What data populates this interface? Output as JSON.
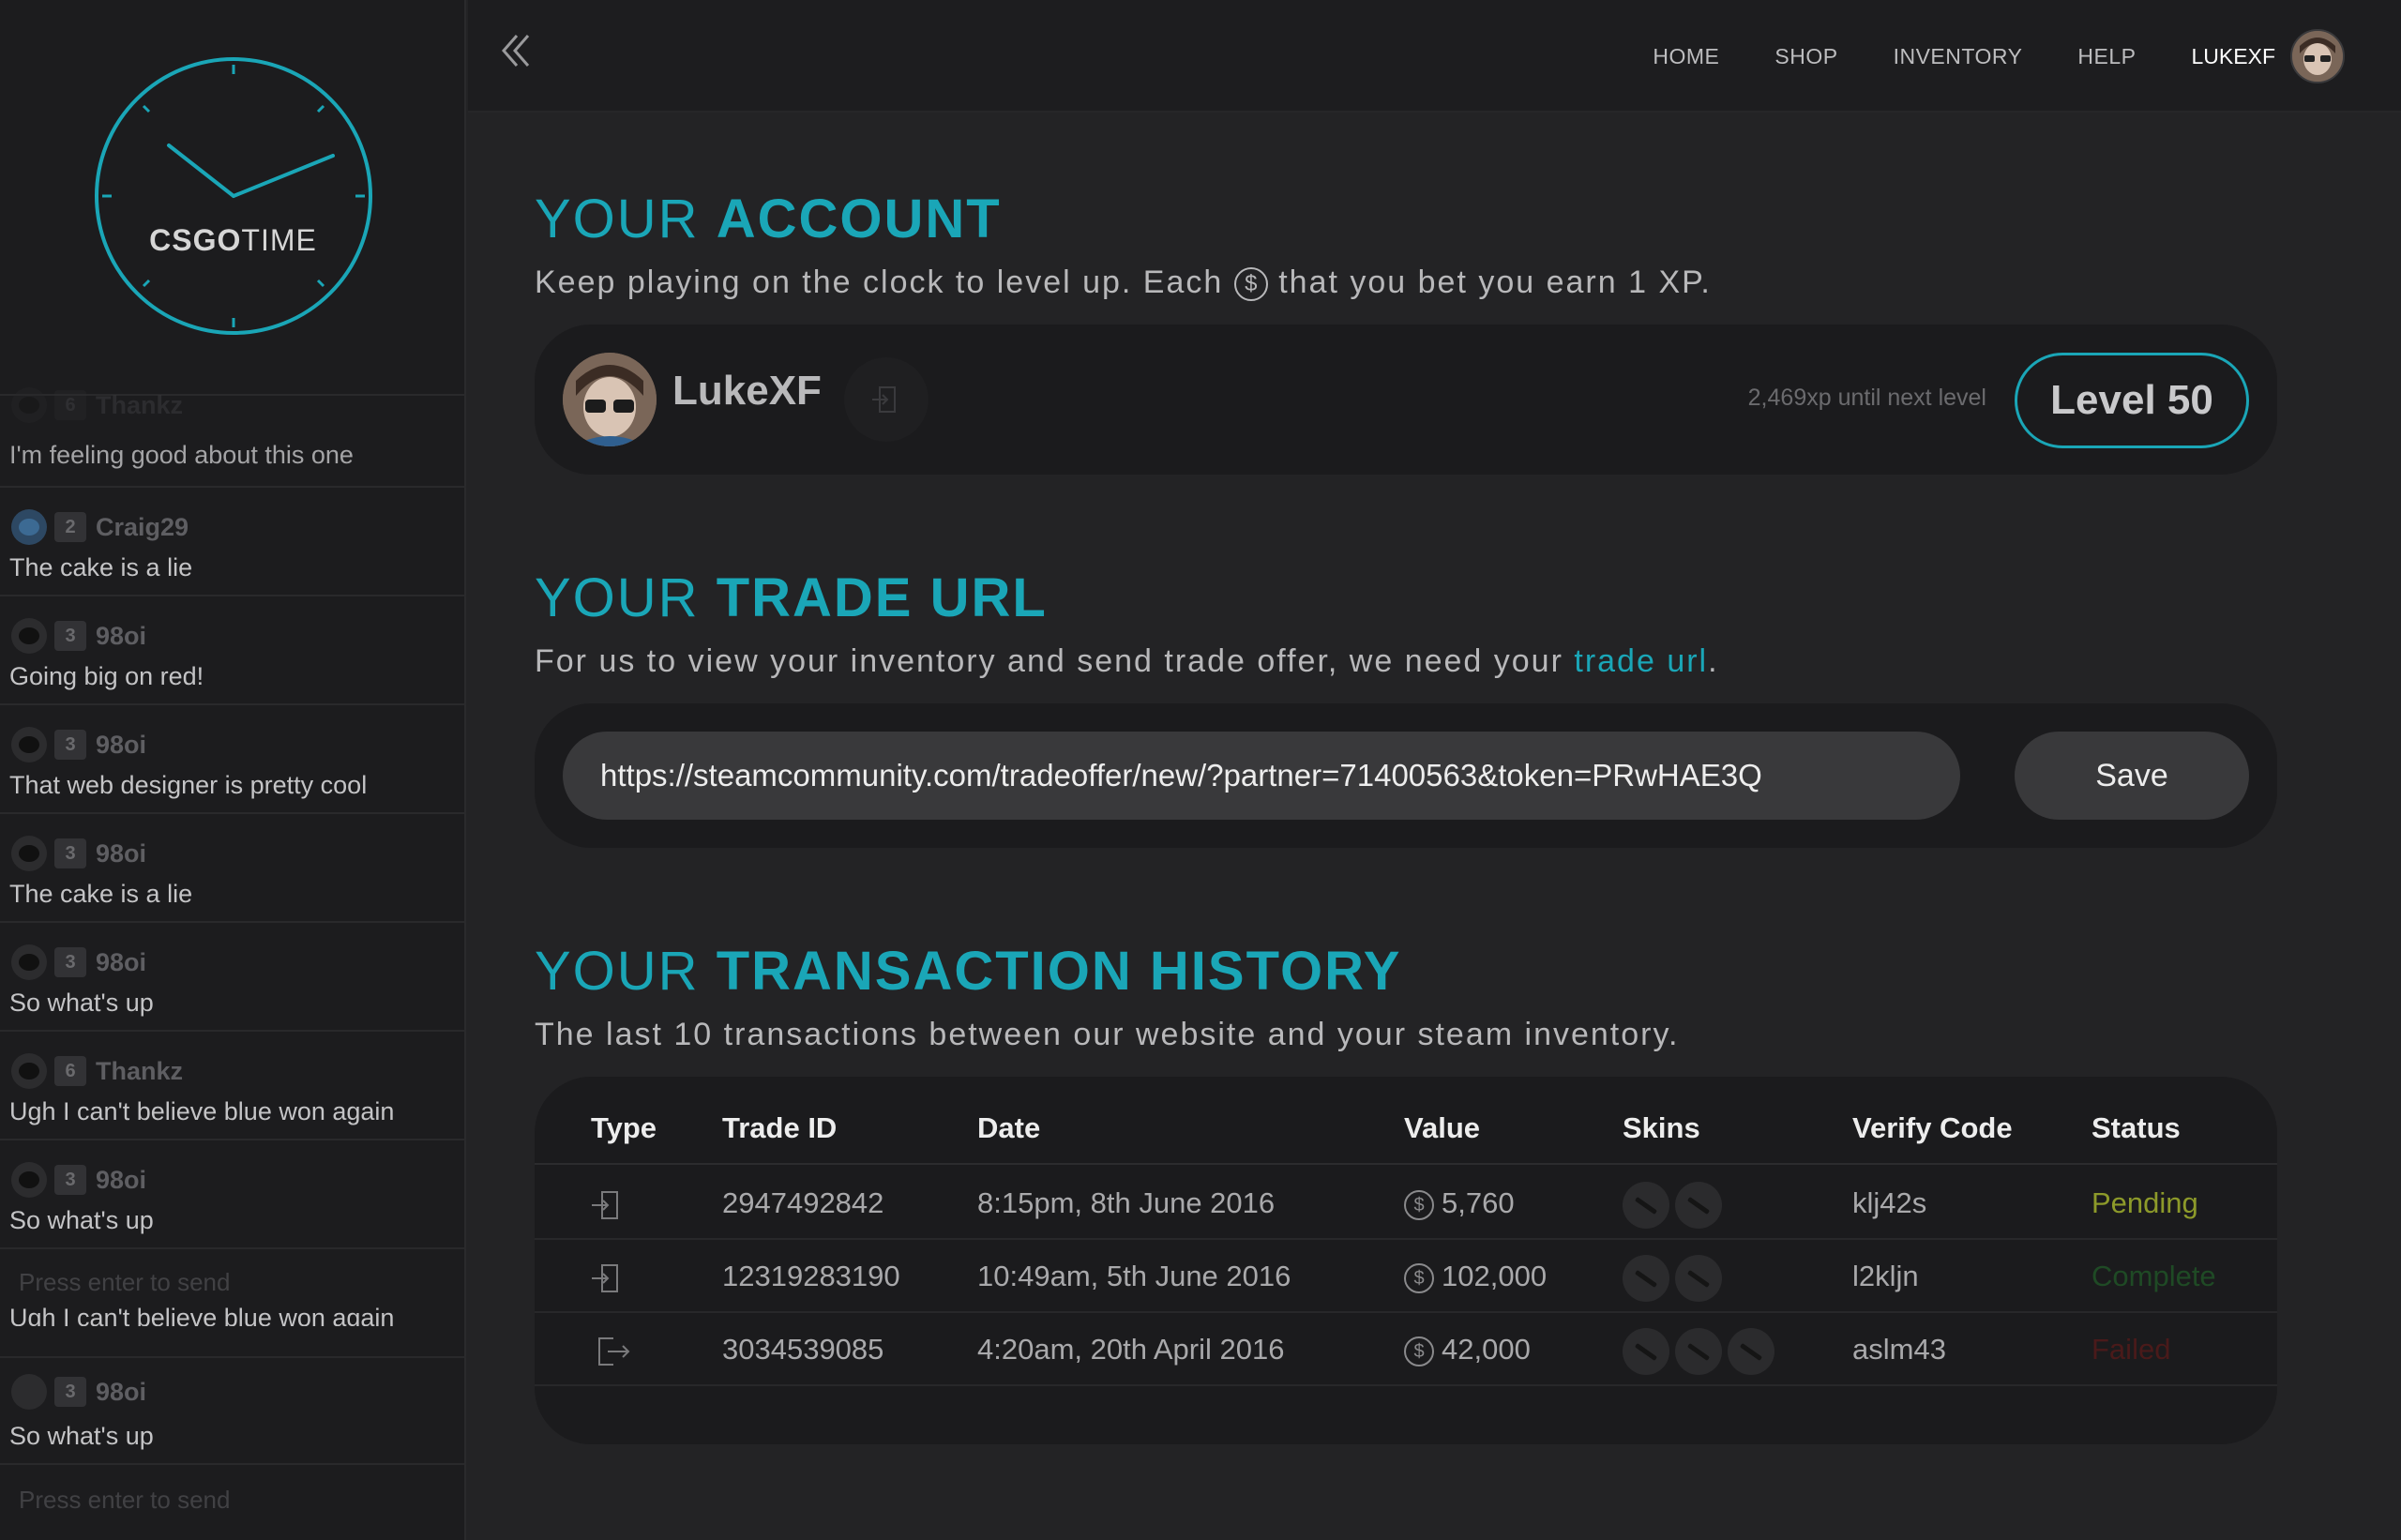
{
  "logo": {
    "brand_bold": "CSGO",
    "brand_light": "TIME"
  },
  "chat": {
    "first": {
      "level": "6",
      "user": "Thankz",
      "text": "I'm feeling good about this one"
    },
    "messages": [
      {
        "level": "2",
        "user": "Craig29",
        "text": "The cake is a lie",
        "avatar": "blue"
      },
      {
        "level": "3",
        "user": "98oi",
        "text": "Going big on red!"
      },
      {
        "level": "3",
        "user": "98oi",
        "text": "That web designer is pretty cool"
      },
      {
        "level": "3",
        "user": "98oi",
        "text": "The cake is a lie"
      },
      {
        "level": "3",
        "user": "98oi",
        "text": "So what's up"
      },
      {
        "level": "6",
        "user": "Thankz",
        "text": "Ugh I can't believe blue won again"
      },
      {
        "level": "3",
        "user": "98oi",
        "text": "So what's up"
      }
    ],
    "input_placeholder": "Press enter to send",
    "overlap_text": "Ugh I can't believe blue won again",
    "last": {
      "level": "3",
      "user": "98oi",
      "text": "So what's up"
    }
  },
  "nav": {
    "items": [
      "HOME",
      "SHOP",
      "INVENTORY",
      "HELP"
    ],
    "username": "LUKEXF"
  },
  "account": {
    "title_light": "YOUR ",
    "title_bold": "ACCOUNT",
    "subtitle_a": "Keep playing on the clock to level up. Each ",
    "subtitle_coin": "$",
    "subtitle_b": " that you bet you earn 1 XP.",
    "name": "LukeXF",
    "xp_text": "2,469xp until next level",
    "level": "Level 50"
  },
  "trade": {
    "title_light": "YOUR ",
    "title_bold": "TRADE URL",
    "subtitle_a": "For us to view your inventory and send trade offer, we need your ",
    "subtitle_link": "trade url",
    "subtitle_b": ".",
    "url": "https://steamcommunity.com/tradeoffer/new/?partner=71400563&token=PRwHAE3Q",
    "save_label": "Save"
  },
  "history": {
    "title_light": "YOUR ",
    "title_bold": "TRANSACTION HISTORY",
    "subtitle": "The last 10 transactions between our website and your steam inventory.",
    "columns": [
      "Type",
      "Trade ID",
      "Date",
      "Value",
      "Skins",
      "Verify Code",
      "Status"
    ],
    "rows": [
      {
        "type": "deposit",
        "trade_id": "2947492842",
        "date": "8:15pm, 8th June 2016",
        "value": "5,760",
        "skins": 2,
        "verify": "klj42s",
        "status": "Pending",
        "status_color": "#8d9a2a"
      },
      {
        "type": "deposit",
        "trade_id": "12319283190",
        "date": "10:49am, 5th June 2016",
        "value": "102,000",
        "skins": 2,
        "verify": "l2kljn",
        "status": "Complete",
        "status_color": "#1f4a25"
      },
      {
        "type": "withdraw",
        "trade_id": "3034539085",
        "date": "4:20am, 20th April 2016",
        "value": "42,000",
        "skins": 3,
        "verify": "aslm43",
        "status": "Failed",
        "status_color": "#4a1a1a"
      }
    ]
  },
  "colors": {
    "accent": "#1aa6b7",
    "bg": "#232325",
    "sidebar": "#1c1c1e",
    "card": "#1b1b1d"
  }
}
